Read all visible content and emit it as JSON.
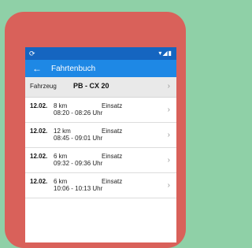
{
  "statusbar": {
    "left_icon": "⟳",
    "right_icons": "▾◢▮"
  },
  "appbar": {
    "back_icon": "←",
    "title": "Fahrtenbuch"
  },
  "vehicle": {
    "label": "Fahrzeug",
    "plate": "PB - CX 20",
    "chevron": "›"
  },
  "trips": [
    {
      "date": "12.02.",
      "km": "8 km",
      "type": "Einsatz",
      "time": "08:20 - 08:26 Uhr",
      "chevron": "›"
    },
    {
      "date": "12.02.",
      "km": "12 km",
      "type": "Einsatz",
      "time": "08:45 - 09:01 Uhr",
      "chevron": "›"
    },
    {
      "date": "12.02.",
      "km": "6 km",
      "type": "Einsatz",
      "time": "09:32 - 09:36 Uhr",
      "chevron": "›"
    },
    {
      "date": "12.02.",
      "km": "6 km",
      "type": "Einsatz",
      "time": "10:06 - 10:13 Uhr",
      "chevron": "›"
    }
  ],
  "colors": {
    "background": "#8fd0a7",
    "tile": "#d9615a",
    "statusbar": "#1565c0",
    "appbar": "#1e88e5"
  }
}
